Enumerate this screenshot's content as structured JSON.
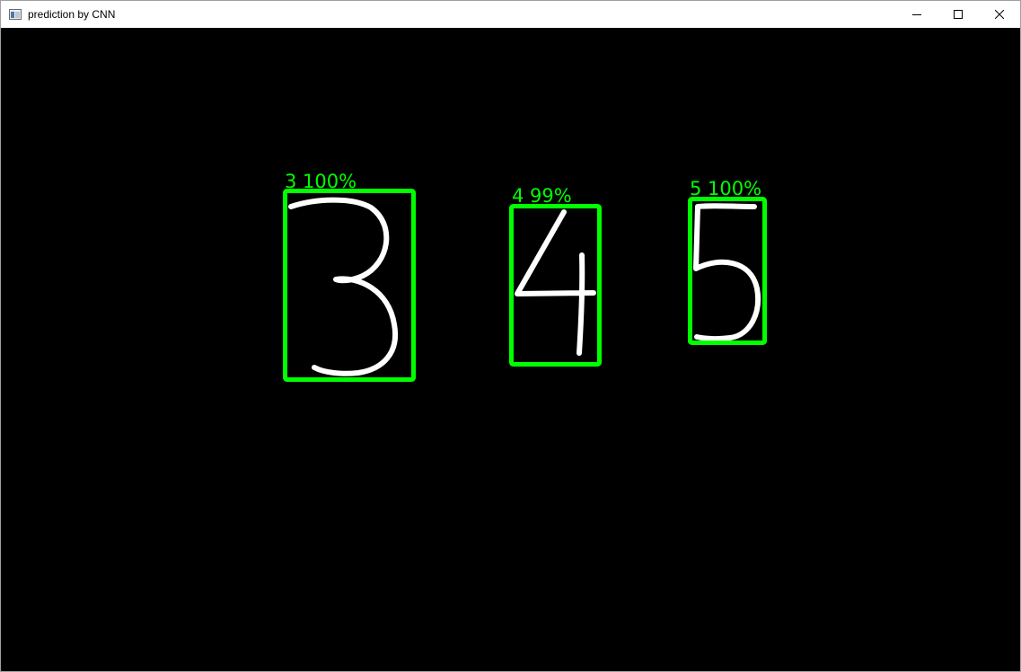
{
  "window": {
    "title": "prediction by CNN",
    "icons": {
      "app": "window-app-icon",
      "minimize": "minimize-icon",
      "maximize": "maximize-icon",
      "close": "close-icon"
    }
  },
  "colors": {
    "box": "#00ff00",
    "label": "#00ff00",
    "digit_stroke": "#ffffff",
    "canvas_background": "#000000"
  },
  "predictions": [
    {
      "digit": "3",
      "label": "3 100%"
    },
    {
      "digit": "4",
      "label": "4 99%"
    },
    {
      "digit": "5",
      "label": "5 100%"
    }
  ]
}
